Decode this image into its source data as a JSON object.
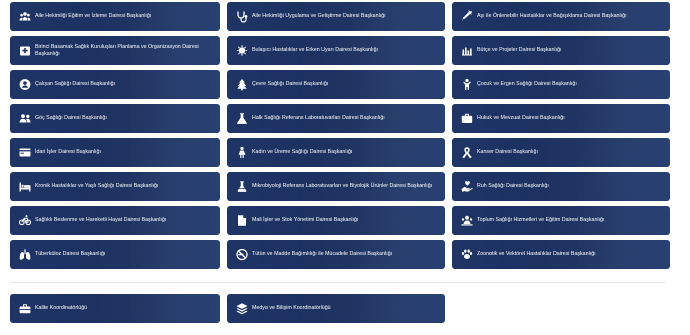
{
  "units": [
    {
      "label": "Aile Hekimliği Eğitim ve İzleme Dairesi Başkanlığı",
      "icon": "people-group-icon"
    },
    {
      "label": "Aile Hekimliği Uygulama ve Geliştirme Dairesi Başkanlığı",
      "icon": "stethoscope-icon"
    },
    {
      "label": "Aşı ile Önlenebilir Hastalıklar ve Bağışıklama Dairesi Başkanlığı",
      "icon": "syringe-icon"
    },
    {
      "label": "Birinci Basamak Sağlık Kuruluşları Planlama ve Organizasyon Dairesi Başkanlığı",
      "icon": "hospital-icon"
    },
    {
      "label": "Bulaşıcı Hastalıklar ve Erken Uyarı Dairesi Başkanlığı",
      "icon": "virus-icon"
    },
    {
      "label": "Bütçe ve Projeler Dairesi Başkanlığı",
      "icon": "bar-chart-icon"
    },
    {
      "label": "Çalışan Sağlığı Dairesi Başkanlığı",
      "icon": "user-circle-icon"
    },
    {
      "label": "Çevre Sağlığı Dairesi Başkanlığı",
      "icon": "tree-icon"
    },
    {
      "label": "Çocuk ve Ergen Sağlığı Dairesi Başkanlığı",
      "icon": "child-icon"
    },
    {
      "label": "Göç Sağlığı Dairesi Başkanlığı",
      "icon": "users-icon"
    },
    {
      "label": "Halk Sağlığı Referans Laboratuvarları Dairesi Başkanlığı",
      "icon": "lab-flask-icon"
    },
    {
      "label": "Hukuk ve Mevzuat Dairesi Başkanlığı",
      "icon": "briefcase-icon"
    },
    {
      "label": "İdari İşler Dairesi Başkanlığı",
      "icon": "id-card-icon"
    },
    {
      "label": "Kadın ve Üreme Sağlığı Dairesi Başkanlığı",
      "icon": "woman-icon"
    },
    {
      "label": "Kanser Dairesi Başkanlığı",
      "icon": "ribbon-icon"
    },
    {
      "label": "Kronik Hastalıklar ve Yaşlı Sağlığı Dairesi Başkanlığı",
      "icon": "bed-icon"
    },
    {
      "label": "Mikrobiyoloji Referans Laboratuvarları ve Biyolojik Ürünler Dairesi Başkanlığı",
      "icon": "flask-icon"
    },
    {
      "label": "Ruh Sağlığı Dairesi Başkanlığı",
      "icon": "hand-heart-icon"
    },
    {
      "label": "Sağlıklı Beslenme ve Hareketli Hayat Dairesi Başkanlığı",
      "icon": "bicycle-icon"
    },
    {
      "label": "Mali İşler ve Stok Yönetimi Dairesi Başkanlığı",
      "icon": "document-icon"
    },
    {
      "label": "Toplum Sağlığı Hizmetleri ve Eğitim Dairesi Başkanlığı",
      "icon": "community-icon"
    },
    {
      "label": "Tüberküloz Dairesi Başkanlığı",
      "icon": "lungs-icon"
    },
    {
      "label": "Tütün ve Madde Bağımlılığı ile Mücadele Dairesi Başkanlığı",
      "icon": "no-smoking-icon"
    },
    {
      "label": "Zoonotik ve Vektörel Hastalıklar Dairesi Başkanlığı",
      "icon": "paw-icon"
    }
  ],
  "coordinators": [
    {
      "label": "Kalite Koordinatörlüğü",
      "icon": "toolbox-icon"
    },
    {
      "label": "Medya ve Bilişim Koordinatörlüğü",
      "icon": "layers-icon"
    }
  ],
  "colors": {
    "tile": "#1f3566",
    "text": "#ffffff",
    "divider": "#e4e7ee"
  }
}
